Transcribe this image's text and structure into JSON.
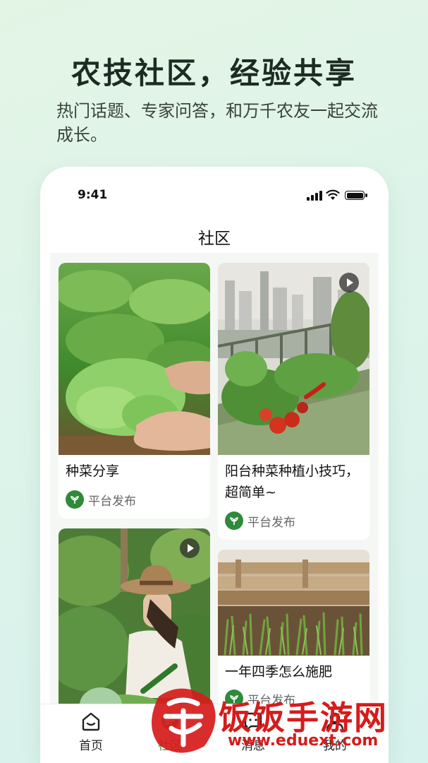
{
  "hero": {
    "title": "农技社区，经验共享",
    "subtitle": "热门话题、专家问答，和万千农友一起交流成长。"
  },
  "status_bar": {
    "time": "9:41"
  },
  "nav": {
    "title": "社区"
  },
  "posts": [
    {
      "title": "种菜分享",
      "author": "平台发布",
      "video": false,
      "image": "lettuce-harvest-photo"
    },
    {
      "title": "阳台种菜种植小技巧，超简单~",
      "author": "平台发布",
      "video": true,
      "image": "balcony-garden-photo"
    },
    {
      "title": "",
      "author": "",
      "video": true,
      "image": "woman-in-garden-photo"
    },
    {
      "title": "一年四季怎么施肥",
      "author": "平台发布",
      "video": false,
      "image": "seedling-beds-photo"
    }
  ],
  "tabs": [
    {
      "label": "首页",
      "icon": "home-icon"
    },
    {
      "label": "社区",
      "icon": "community-icon",
      "active": true
    },
    {
      "label": "消息",
      "icon": "message-icon"
    },
    {
      "label": "我的",
      "icon": "profile-icon"
    }
  ],
  "watermark": {
    "text": "饭饭手游网",
    "url": "www.eduext.com",
    "glyph": "饭"
  },
  "colors": {
    "brand_green": "#2f8a3a",
    "watermark_red": "#d61b1b"
  }
}
